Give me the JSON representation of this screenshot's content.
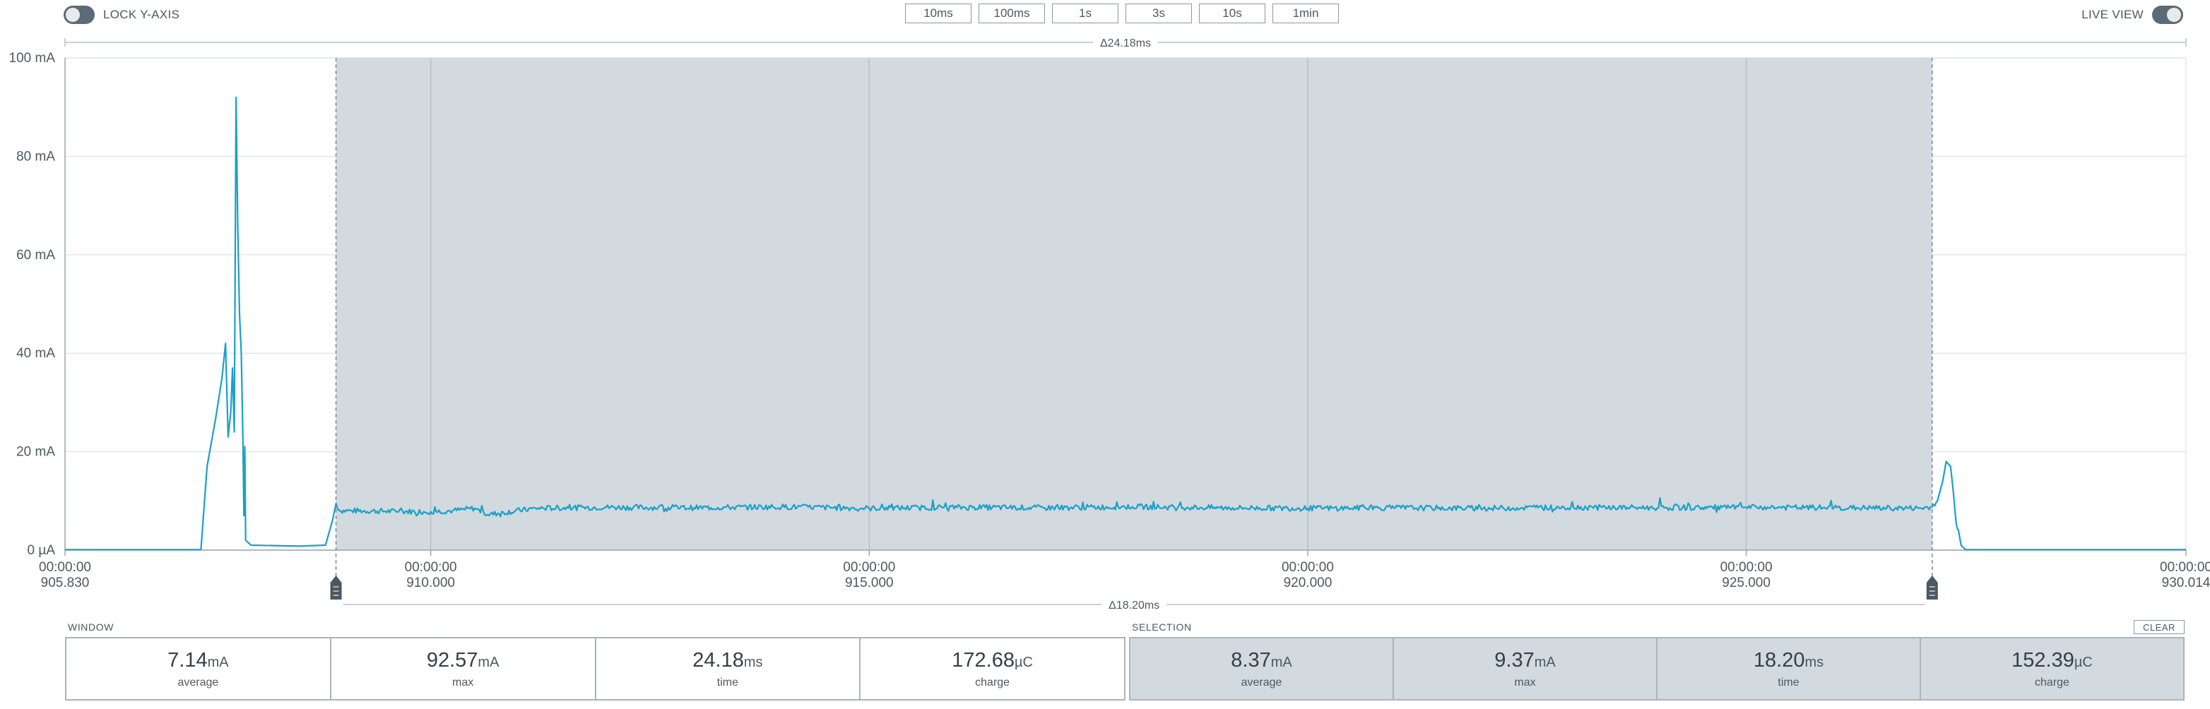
{
  "toolbar": {
    "lock_y_axis_label": "LOCK Y-AXIS",
    "lock_y_axis_on": false,
    "live_view_label": "LIVE VIEW",
    "live_view_on": true,
    "zoom_buttons": [
      "10ms",
      "100ms",
      "1s",
      "3s",
      "10s",
      "1min"
    ]
  },
  "chart_data": {
    "type": "line",
    "title": "",
    "xlabel": "",
    "ylabel": "",
    "x_unit": "ms",
    "y_unit": "mA",
    "xlim": [
      905.83,
      930.014
    ],
    "ylim": [
      0,
      100
    ],
    "y_ticks": [
      {
        "value": 0,
        "label": "0 µA"
      },
      {
        "value": 20,
        "label": "20 mA"
      },
      {
        "value": 40,
        "label": "40 mA"
      },
      {
        "value": 60,
        "label": "60 mA"
      },
      {
        "value": 80,
        "label": "80 mA"
      },
      {
        "value": 100,
        "label": "100 mA"
      }
    ],
    "x_ticks": [
      {
        "value": 905.83,
        "time": "00:00:00",
        "label": "905.830"
      },
      {
        "value": 910.0,
        "time": "00:00:00",
        "label": "910.000"
      },
      {
        "value": 915.0,
        "time": "00:00:00",
        "label": "915.000"
      },
      {
        "value": 920.0,
        "time": "00:00:00",
        "label": "920.000"
      },
      {
        "value": 925.0,
        "time": "00:00:00",
        "label": "925.000"
      },
      {
        "value": 930.014,
        "time": "00:00:00",
        "label": "930.014"
      }
    ],
    "grid": true,
    "window_delta_label": "Δ24.18ms",
    "selection": {
      "start": 908.92,
      "end": 927.12,
      "delta_label": "Δ18.20ms"
    },
    "series": [
      {
        "color": "#1aa0c8",
        "points": [
          [
            905.83,
            0.1
          ],
          [
            907.38,
            0.1
          ],
          [
            907.45,
            17
          ],
          [
            907.55,
            27
          ],
          [
            907.62,
            35
          ],
          [
            907.66,
            42
          ],
          [
            907.69,
            23
          ],
          [
            907.72,
            28
          ],
          [
            907.74,
            37
          ],
          [
            907.76,
            24
          ],
          [
            907.78,
            92
          ],
          [
            907.8,
            66
          ],
          [
            907.82,
            48
          ],
          [
            907.84,
            40
          ],
          [
            907.86,
            21
          ],
          [
            907.87,
            7
          ],
          [
            907.88,
            21
          ],
          [
            907.89,
            2
          ],
          [
            907.95,
            1
          ],
          [
            908.5,
            0.8
          ],
          [
            908.8,
            1
          ],
          [
            908.88,
            6
          ],
          [
            908.92,
            9.5
          ],
          [
            908.96,
            8
          ],
          [
            909.1,
            8
          ],
          [
            910.0,
            7.8
          ],
          [
            910.25,
            8
          ],
          [
            910.5,
            8.5
          ],
          [
            910.65,
            7.2
          ],
          [
            911.2,
            8.5
          ],
          [
            912.0,
            8.7
          ],
          [
            913.0,
            8.6
          ],
          [
            914.0,
            8.8
          ],
          [
            915.0,
            8.5
          ],
          [
            916.0,
            8.7
          ],
          [
            917.0,
            8.6
          ],
          [
            918.0,
            8.8
          ],
          [
            919.0,
            8.6
          ],
          [
            920.0,
            8.5
          ],
          [
            921.0,
            8.6
          ],
          [
            922.0,
            8.5
          ],
          [
            923.0,
            8.7
          ],
          [
            924.0,
            8.6
          ],
          [
            925.0,
            8.7
          ],
          [
            926.0,
            8.6
          ],
          [
            927.0,
            8.5
          ],
          [
            927.12,
            8.8
          ],
          [
            927.18,
            10
          ],
          [
            927.24,
            14
          ],
          [
            927.28,
            18
          ],
          [
            927.33,
            17
          ],
          [
            927.36,
            12
          ],
          [
            927.39,
            6
          ],
          [
            927.42,
            4
          ],
          [
            927.45,
            1
          ],
          [
            927.5,
            0.1
          ],
          [
            930.014,
            0.1
          ]
        ],
        "noise_amplitude": 0.55
      }
    ]
  },
  "stats": {
    "window_title": "WINDOW",
    "selection_title": "SELECTION",
    "clear_label": "CLEAR",
    "window": [
      {
        "value": "7.14",
        "unit": "mA",
        "caption": "average"
      },
      {
        "value": "92.57",
        "unit": "mA",
        "caption": "max"
      },
      {
        "value": "24.18",
        "unit": "ms",
        "caption": "time"
      },
      {
        "value": "172.68",
        "unit": "µC",
        "caption": "charge"
      }
    ],
    "selection": [
      {
        "value": "8.37",
        "unit": "mA",
        "caption": "average"
      },
      {
        "value": "9.37",
        "unit": "mA",
        "caption": "max"
      },
      {
        "value": "18.20",
        "unit": "ms",
        "caption": "time"
      },
      {
        "value": "152.39",
        "unit": "µC",
        "caption": "charge"
      }
    ]
  }
}
